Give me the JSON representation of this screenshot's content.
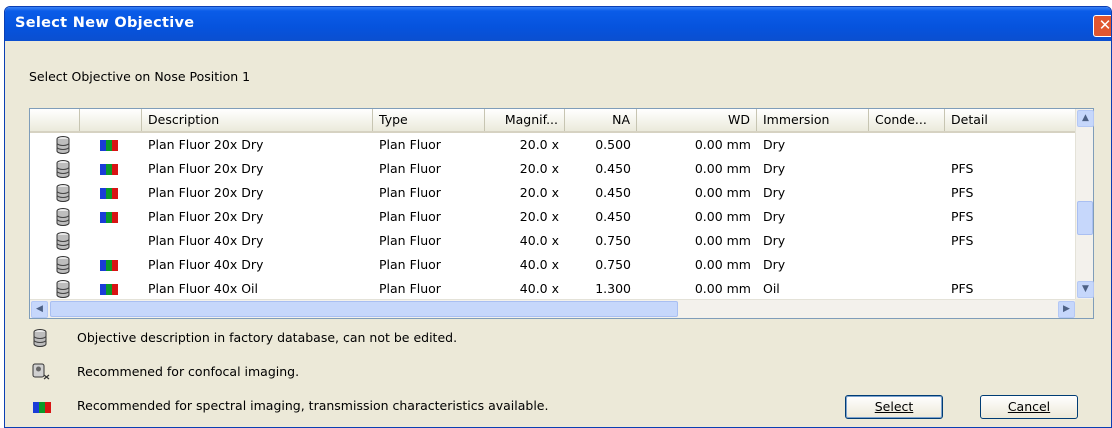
{
  "window": {
    "title": "Select New Objective",
    "close_glyph": "✕"
  },
  "subtitle": "Select Objective on Nose Position 1",
  "columns": [
    "Description",
    "Type",
    "Magnif...",
    "NA",
    "WD",
    "Immersion",
    "Conde...",
    "Detail"
  ],
  "rows": [
    {
      "db": true,
      "spectral": true,
      "description": "Plan Fluor 20x Dry",
      "type": "Plan Fluor",
      "magnif": "20.0 x",
      "na": "0.500",
      "wd": "0.00 mm",
      "immersion": "Dry",
      "condenser": "",
      "detail": ""
    },
    {
      "db": true,
      "spectral": true,
      "description": "Plan Fluor 20x Dry",
      "type": "Plan Fluor",
      "magnif": "20.0 x",
      "na": "0.450",
      "wd": "0.00 mm",
      "immersion": "Dry",
      "condenser": "",
      "detail": "PFS"
    },
    {
      "db": true,
      "spectral": true,
      "description": "Plan Fluor 20x Dry",
      "type": "Plan Fluor",
      "magnif": "20.0 x",
      "na": "0.450",
      "wd": "0.00 mm",
      "immersion": "Dry",
      "condenser": "",
      "detail": "PFS"
    },
    {
      "db": true,
      "spectral": true,
      "description": "Plan Fluor 20x Dry",
      "type": "Plan Fluor",
      "magnif": "20.0 x",
      "na": "0.450",
      "wd": "0.00 mm",
      "immersion": "Dry",
      "condenser": "",
      "detail": "PFS"
    },
    {
      "db": true,
      "spectral": false,
      "description": "Plan Fluor 40x Dry",
      "type": "Plan Fluor",
      "magnif": "40.0 x",
      "na": "0.750",
      "wd": "0.00 mm",
      "immersion": "Dry",
      "condenser": "",
      "detail": "PFS"
    },
    {
      "db": true,
      "spectral": true,
      "description": "Plan Fluor 40x Dry",
      "type": "Plan Fluor",
      "magnif": "40.0 x",
      "na": "0.750",
      "wd": "0.00 mm",
      "immersion": "Dry",
      "condenser": "",
      "detail": ""
    },
    {
      "db": true,
      "spectral": true,
      "description": "Plan Fluor 40x Oil",
      "type": "Plan Fluor",
      "magnif": "40.0 x",
      "na": "1.300",
      "wd": "0.00 mm",
      "immersion": "Oil",
      "condenser": "",
      "detail": "PFS"
    }
  ],
  "scrollbar": {
    "up_glyph": "▲",
    "down_glyph": "▼",
    "left_glyph": "◀",
    "right_glyph": "▶"
  },
  "legend": {
    "database": "Objective description in factory database, can not be edited.",
    "confocal": "Recommened for confocal imaging.",
    "spectral": "Recommended for spectral imaging, transmission characteristics available."
  },
  "buttons": {
    "select": "Select",
    "cancel": "Cancel"
  },
  "icons": {
    "database": "cylinder-database-icon",
    "confocal": "confocal-icon",
    "spectral": "spectral-bars-icon"
  },
  "colors": {
    "titlebar": "#0653dd",
    "close_button": "#e0562f",
    "spectral_blue": "#1a3cd8",
    "spectral_green": "#0a9a2a",
    "spectral_red": "#d81414",
    "dialog_bg": "#ece9d8"
  }
}
